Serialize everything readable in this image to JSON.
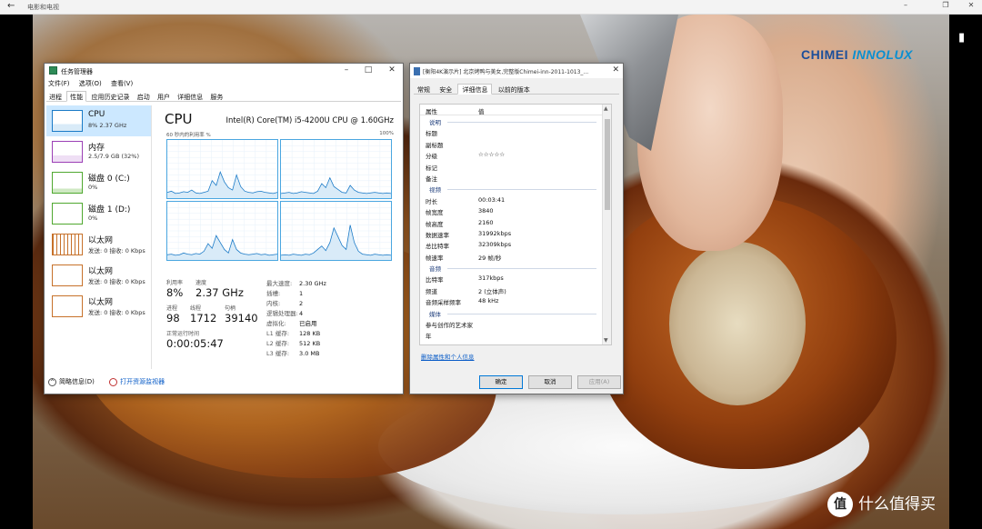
{
  "app": {
    "title": "电影和电视",
    "back_icon": "back-arrow-icon"
  },
  "video": {
    "brand_part1": "CHIMEI",
    "brand_part2": "INNOLUX",
    "watermark_badge": "值",
    "watermark_text": "什么值得买"
  },
  "taskmgr": {
    "title": "任务管理器",
    "menu": [
      "文件(F)",
      "选项(O)",
      "查看(V)"
    ],
    "tabs": [
      "进程",
      "性能",
      "应用历史记录",
      "启动",
      "用户",
      "详细信息",
      "服务"
    ],
    "active_tab": "性能",
    "sidebar": [
      {
        "name": "CPU",
        "sub": "8% 2.37 GHz",
        "color": "#1a7ac7"
      },
      {
        "name": "内存",
        "sub": "2.5/7.9 GB (32%)",
        "color": "#9b3fb5"
      },
      {
        "name": "磁盘 0 (C:)",
        "sub": "0%",
        "color": "#4fa82f"
      },
      {
        "name": "磁盘 1 (D:)",
        "sub": "0%",
        "color": "#4fa82f"
      },
      {
        "name": "以太网",
        "sub": "发送: 0 接收: 0 Kbps",
        "color": "#c7712a"
      },
      {
        "name": "以太网",
        "sub": "发送: 0 接收: 0 Kbps",
        "color": "#c7712a"
      },
      {
        "name": "以太网",
        "sub": "发送: 0 接收: 0 Kbps",
        "color": "#c7712a"
      }
    ],
    "main": {
      "title": "CPU",
      "model": "Intel(R) Core(TM) i5-4200U CPU @ 1.60GHz",
      "util_label": "60 秒内的利用率 %",
      "pct_label": "100%",
      "graph_color": "#1a7ac7",
      "graphs": [
        [
          10,
          12,
          8,
          9,
          11,
          10,
          14,
          9,
          8,
          10,
          12,
          30,
          22,
          45,
          28,
          18,
          14,
          40,
          20,
          12,
          10,
          9,
          11,
          12,
          10,
          9,
          8,
          10
        ],
        [
          8,
          9,
          10,
          8,
          9,
          11,
          10,
          9,
          8,
          12,
          25,
          18,
          35,
          20,
          15,
          10,
          9,
          22,
          14,
          10,
          9,
          8,
          9,
          10,
          9,
          8,
          9,
          8
        ],
        [
          9,
          10,
          8,
          9,
          12,
          10,
          9,
          11,
          10,
          15,
          28,
          20,
          42,
          30,
          18,
          12,
          35,
          18,
          12,
          10,
          9,
          10,
          11,
          9,
          10,
          8,
          9,
          10
        ],
        [
          8,
          9,
          8,
          10,
          9,
          8,
          10,
          9,
          12,
          18,
          24,
          16,
          30,
          55,
          40,
          25,
          18,
          60,
          30,
          15,
          10,
          9,
          8,
          10,
          9,
          8,
          9,
          8
        ]
      ],
      "stats": {
        "util_label": "利用率",
        "util_value": "8%",
        "speed_label": "速度",
        "speed_value": "2.37 GHz",
        "proc_label": "进程",
        "proc_value": "98",
        "thread_label": "线程",
        "thread_value": "1712",
        "handle_label": "句柄",
        "handle_value": "39140",
        "uptime_label": "正常运行时间",
        "uptime_value": "0:00:05:47"
      },
      "specs": [
        {
          "k": "最大速度:",
          "v": "2.30 GHz"
        },
        {
          "k": "插槽:",
          "v": "1"
        },
        {
          "k": "内核:",
          "v": "2"
        },
        {
          "k": "逻辑处理器:",
          "v": "4"
        },
        {
          "k": "虚拟化:",
          "v": "已启用"
        },
        {
          "k": "L1 缓存:",
          "v": "128 KB"
        },
        {
          "k": "L2 缓存:",
          "v": "512 KB"
        },
        {
          "k": "L3 缓存:",
          "v": "3.0 MB"
        }
      ]
    },
    "footer": {
      "summary": "简略信息(D)",
      "monitor": "打开资源监视器"
    }
  },
  "props": {
    "title": "[衡阳4K演示片] 北京烤鸭与美女,完整版Chimei-inn-2011-1013_...",
    "tabs": [
      "常规",
      "安全",
      "详细信息",
      "以前的版本"
    ],
    "active_tab": "详细信息",
    "header": {
      "c1": "属性",
      "c2": "值"
    },
    "rows": [
      {
        "type": "sec",
        "k": "说明"
      },
      {
        "type": "row",
        "k": "标题",
        "v": ""
      },
      {
        "type": "row",
        "k": "副标题",
        "v": ""
      },
      {
        "type": "row",
        "k": "分级",
        "v": "☆☆☆☆☆"
      },
      {
        "type": "row",
        "k": "标记",
        "v": ""
      },
      {
        "type": "row",
        "k": "备注",
        "v": ""
      },
      {
        "type": "sec",
        "k": "视频"
      },
      {
        "type": "row",
        "k": "时长",
        "v": "00:03:41"
      },
      {
        "type": "row",
        "k": "帧宽度",
        "v": "3840"
      },
      {
        "type": "row",
        "k": "帧高度",
        "v": "2160"
      },
      {
        "type": "row",
        "k": "数据速率",
        "v": "31992kbps"
      },
      {
        "type": "row",
        "k": "总比特率",
        "v": "32309kbps"
      },
      {
        "type": "row",
        "k": "帧速率",
        "v": "29 帧/秒"
      },
      {
        "type": "sec",
        "k": "音频"
      },
      {
        "type": "row",
        "k": "比特率",
        "v": "317kbps"
      },
      {
        "type": "row",
        "k": "频道",
        "v": "2 (立体声)"
      },
      {
        "type": "row",
        "k": "音频采样频率",
        "v": "48 kHz"
      },
      {
        "type": "sec",
        "k": "媒体"
      },
      {
        "type": "row",
        "k": "参与创作的艺术家",
        "v": ""
      },
      {
        "type": "row",
        "k": "年",
        "v": ""
      }
    ],
    "link": "删除属性和个人信息",
    "buttons": {
      "ok": "确定",
      "cancel": "取消",
      "apply": "应用(A)"
    }
  }
}
